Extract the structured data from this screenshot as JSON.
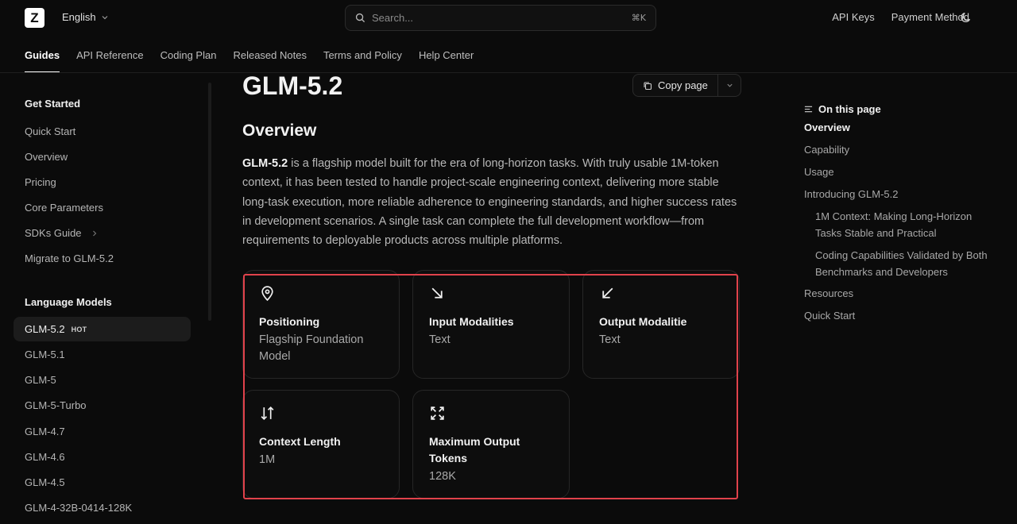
{
  "header": {
    "logo_letter": "Z",
    "language": "English",
    "search_placeholder": "Search...",
    "search_shortcut": "⌘K",
    "links": [
      "API Keys",
      "Payment Method"
    ]
  },
  "nav": {
    "tabs": [
      "Guides",
      "API Reference",
      "Coding Plan",
      "Released Notes",
      "Terms and Policy",
      "Help Center"
    ]
  },
  "sidebar": {
    "get_started_title": "Get Started",
    "get_started": [
      "Quick Start",
      "Overview",
      "Pricing",
      "Core Parameters",
      "SDKs Guide",
      "Migrate to GLM-5.2"
    ],
    "language_models_title": "Language Models",
    "language_models": [
      "GLM-5.2",
      "GLM-5.1",
      "GLM-5",
      "GLM-5-Turbo",
      "GLM-4.7",
      "GLM-4.6",
      "GLM-4.5",
      "GLM-4-32B-0414-128K"
    ],
    "hot_badge": "HOT"
  },
  "main": {
    "title": "GLM-5.2",
    "copy_label": "Copy page",
    "overview_heading": "Overview",
    "intro_bold": "GLM-5.2",
    "intro_text": " is a flagship model built for the era of long-horizon tasks. With truly usable 1M-token context, it has been tested to handle project-scale engineering context, delivering more stable long-task execution, more reliable adherence to engineering standards, and higher success rates in development scenarios. A single task can complete the full development workflow—from requirements to deployable products across multiple platforms.",
    "cards": [
      {
        "icon": "map-pin-icon",
        "title": "Positioning",
        "value": "Flagship Foundation Model"
      },
      {
        "icon": "arrow-down-right-icon",
        "title": "Input Modalities",
        "value": "Text"
      },
      {
        "icon": "arrow-down-left-icon",
        "title": "Output Modalitie",
        "value": "Text"
      },
      {
        "icon": "arrows-up-down-icon",
        "title": "Context Length",
        "value": "1M"
      },
      {
        "icon": "maximize-icon",
        "title": "Maximum Output Tokens",
        "value": "128K"
      }
    ]
  },
  "toc": {
    "heading": "On this page",
    "items": [
      "Overview",
      "Capability",
      "Usage",
      "Introducing GLM-5.2",
      "1M Context: Making Long-Horizon Tasks Stable and Practical",
      "Coding Capabilities Validated by Both Benchmarks and Developers",
      "Resources",
      "Quick Start"
    ]
  },
  "colors": {
    "background": "#0b0b0b",
    "highlight": "#e0424b"
  }
}
